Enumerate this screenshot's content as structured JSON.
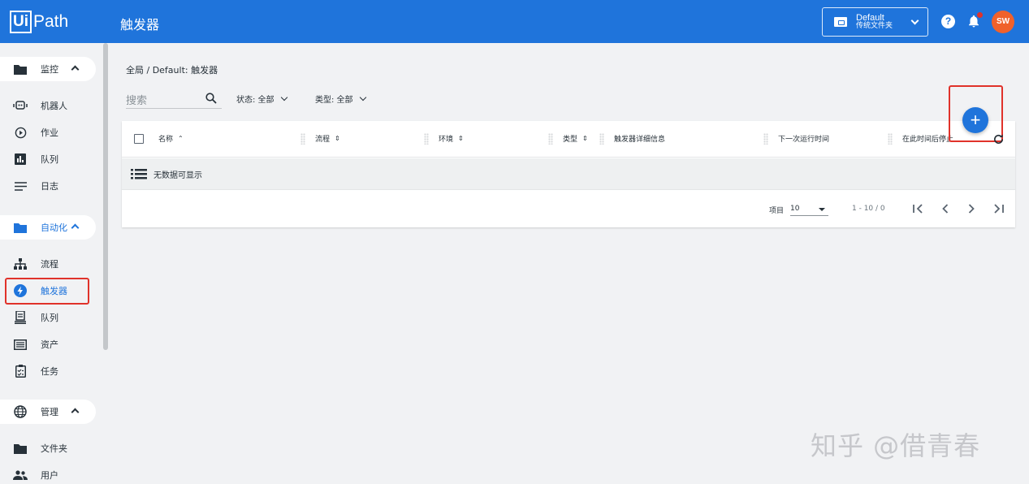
{
  "header": {
    "logo_boxed": "Ui",
    "logo_rest": "Path",
    "title": "触发器",
    "folder_name": "Default",
    "folder_type": "传统文件夹",
    "help_symbol": "?",
    "avatar_initials": "SW",
    "brand_color": "#1f74db",
    "avatar_color": "#f0612b"
  },
  "sidebar": {
    "groups": [
      {
        "label": "监控",
        "icon": "folder-icon",
        "items": [
          {
            "label": "机器人",
            "icon": "robot-icon"
          },
          {
            "label": "作业",
            "icon": "play-circle-icon"
          },
          {
            "label": "队列",
            "icon": "bar-chart-icon"
          },
          {
            "label": "日志",
            "icon": "lines-icon"
          }
        ]
      },
      {
        "label": "自动化",
        "icon": "folder-icon",
        "items": [
          {
            "label": "流程",
            "icon": "hierarchy-icon"
          },
          {
            "label": "触发器",
            "icon": "lightning-icon",
            "active": true
          },
          {
            "label": "队列",
            "icon": "queue-stack-icon"
          },
          {
            "label": "资产",
            "icon": "asset-icon"
          },
          {
            "label": "任务",
            "icon": "task-clipboard-icon"
          }
        ]
      },
      {
        "label": "管理",
        "icon": "globe-icon",
        "items": [
          {
            "label": "文件夹",
            "icon": "folder-icon"
          },
          {
            "label": "用户",
            "icon": "users-icon"
          }
        ]
      }
    ]
  },
  "main": {
    "breadcrumb": "全局 / Default: 触发器",
    "search_placeholder": "搜索",
    "filter_state": "状态: 全部",
    "filter_type": "类型: 全部",
    "columns": [
      "名称",
      "流程",
      "环境",
      "类型",
      "触发器详细信息",
      "下一次运行时间",
      "在此时间后停止"
    ],
    "empty_message": "无数据可显示",
    "items_label": "项目",
    "items_per_page": "10",
    "range_text": "1 - 10 / 0",
    "add_symbol": "+"
  },
  "watermark": "知乎 @借青春"
}
